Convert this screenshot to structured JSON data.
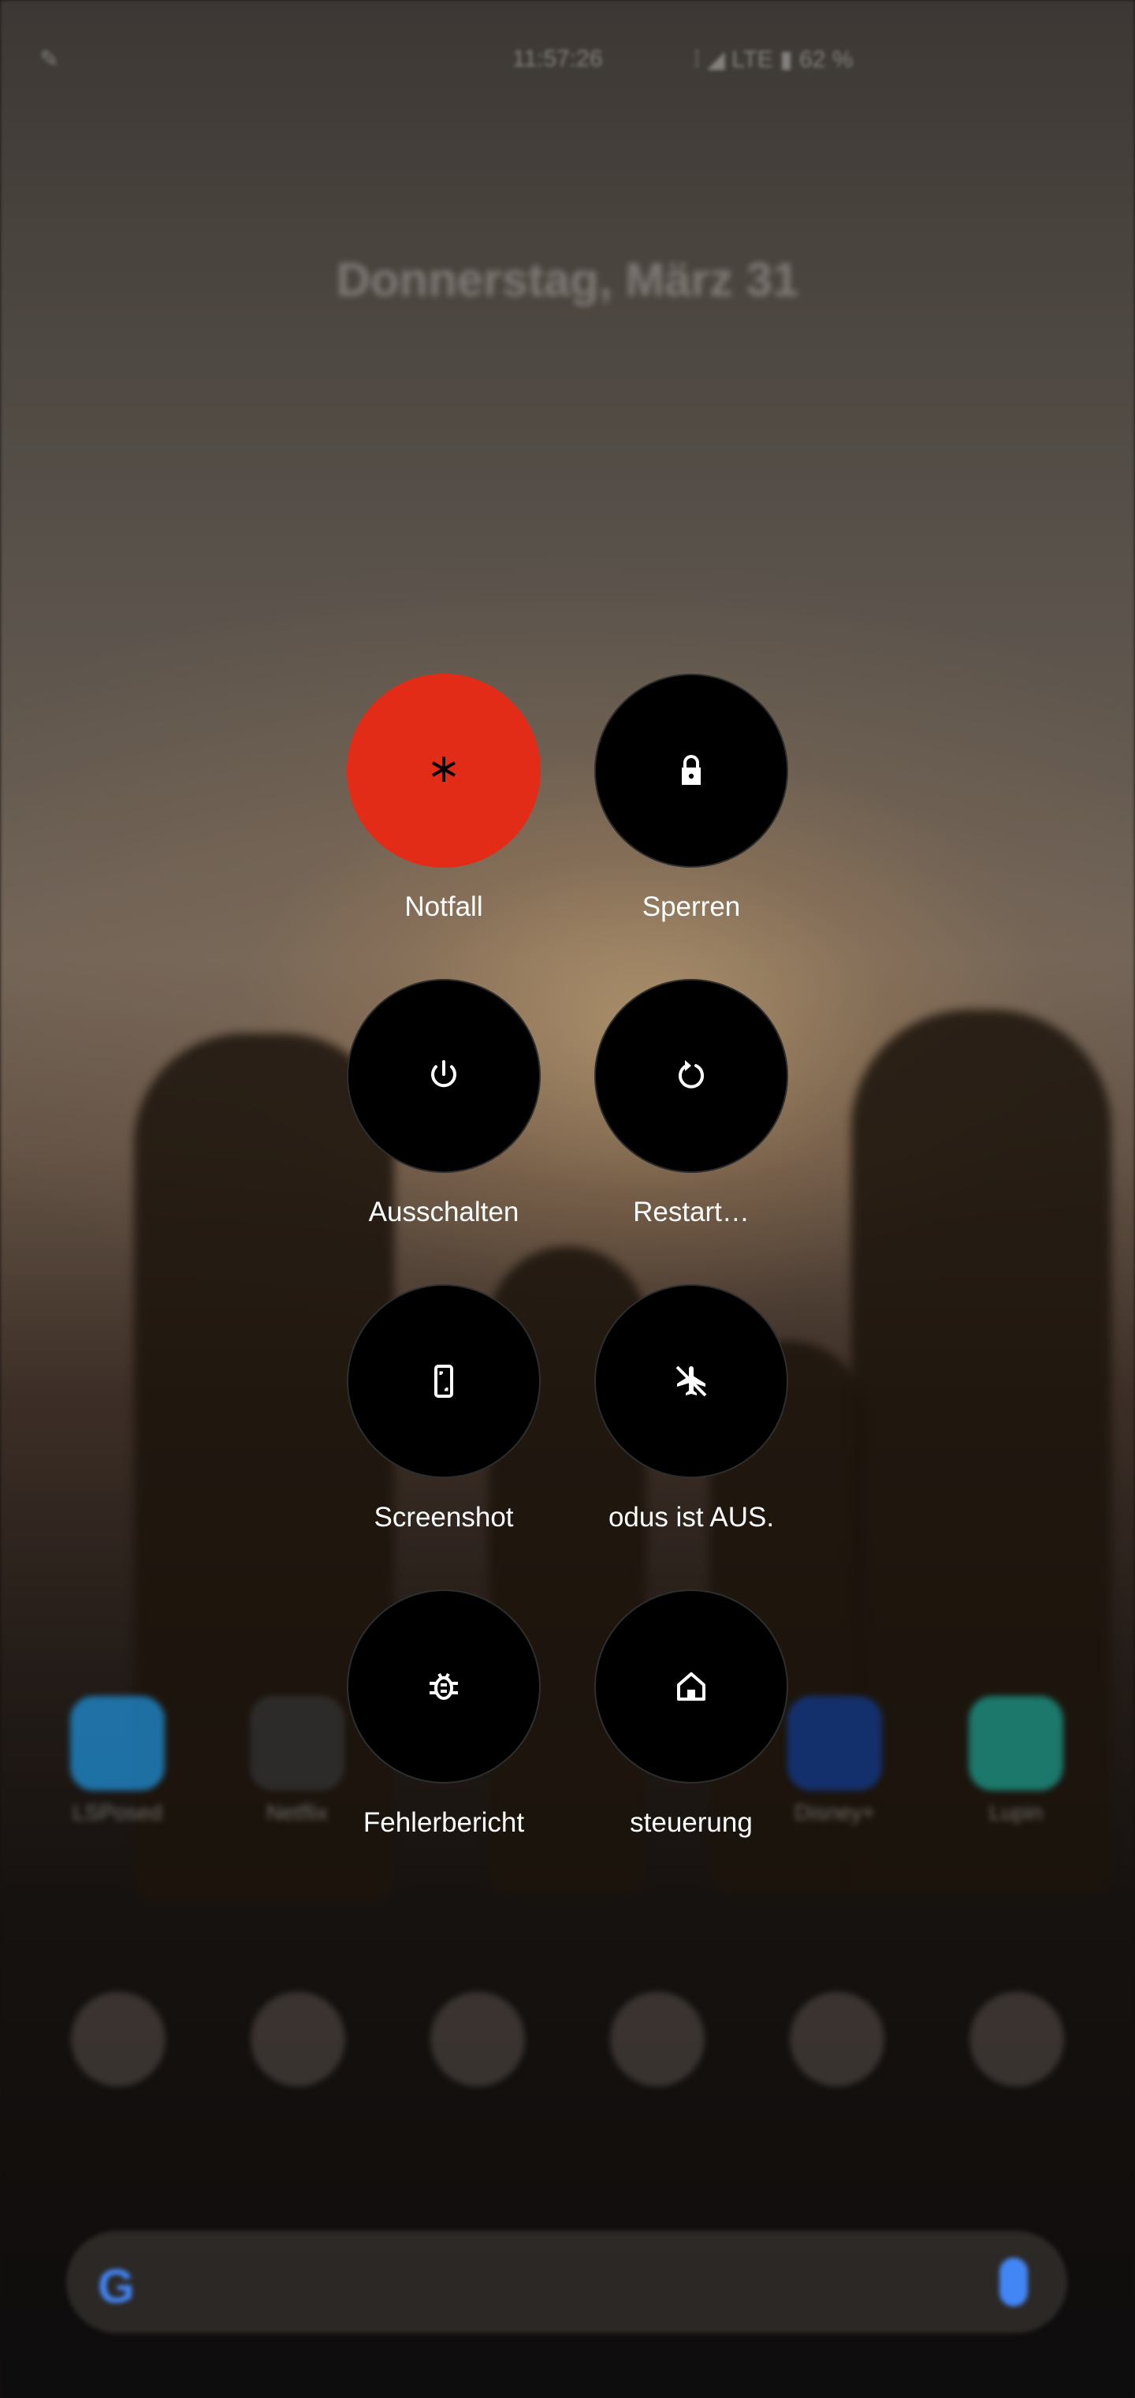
{
  "status_bar": {
    "left_icon": "notification-icon",
    "time": "11:57:26",
    "right_icons": [
      "vibrate-icon",
      "signal-icon",
      "lte-icon",
      "battery-icon"
    ],
    "battery": "62 %"
  },
  "date_widget": "Donnerstag, März 31",
  "home_apps": [
    {
      "label": "LSPosed",
      "color": "#1f8fd6"
    },
    {
      "label": "Netflix",
      "color": "#333333"
    },
    {
      "label": "Disney+",
      "color": "#123a8c"
    },
    {
      "label": "Lupin",
      "color": "#1b9a8a"
    }
  ],
  "dock": [
    "phone-icon",
    "browser-icon",
    "camera-icon",
    "sync-icon",
    "telegram-icon",
    "whatsapp-icon"
  ],
  "search": {
    "logo": "G",
    "mic": "mic-icon"
  },
  "power_menu": {
    "emergency": {
      "label": "Notfall",
      "icon": "asterisk-icon",
      "color": "#e22c17"
    },
    "lock": {
      "label": "Sperren",
      "icon": "lock-icon"
    },
    "power_off": {
      "label": "Ausschalten",
      "icon": "power-icon"
    },
    "restart": {
      "label": "Restart…",
      "icon": "restart-icon"
    },
    "screenshot": {
      "label": "Screenshot",
      "icon": "screenshot-icon"
    },
    "airplane": {
      "label": "odus ist AUS.",
      "icon": "airplane-off-icon"
    },
    "bugreport": {
      "label": "Fehlerbericht",
      "icon": "bug-icon"
    },
    "home_control": {
      "label": "steuerung",
      "icon": "home-icon"
    }
  }
}
